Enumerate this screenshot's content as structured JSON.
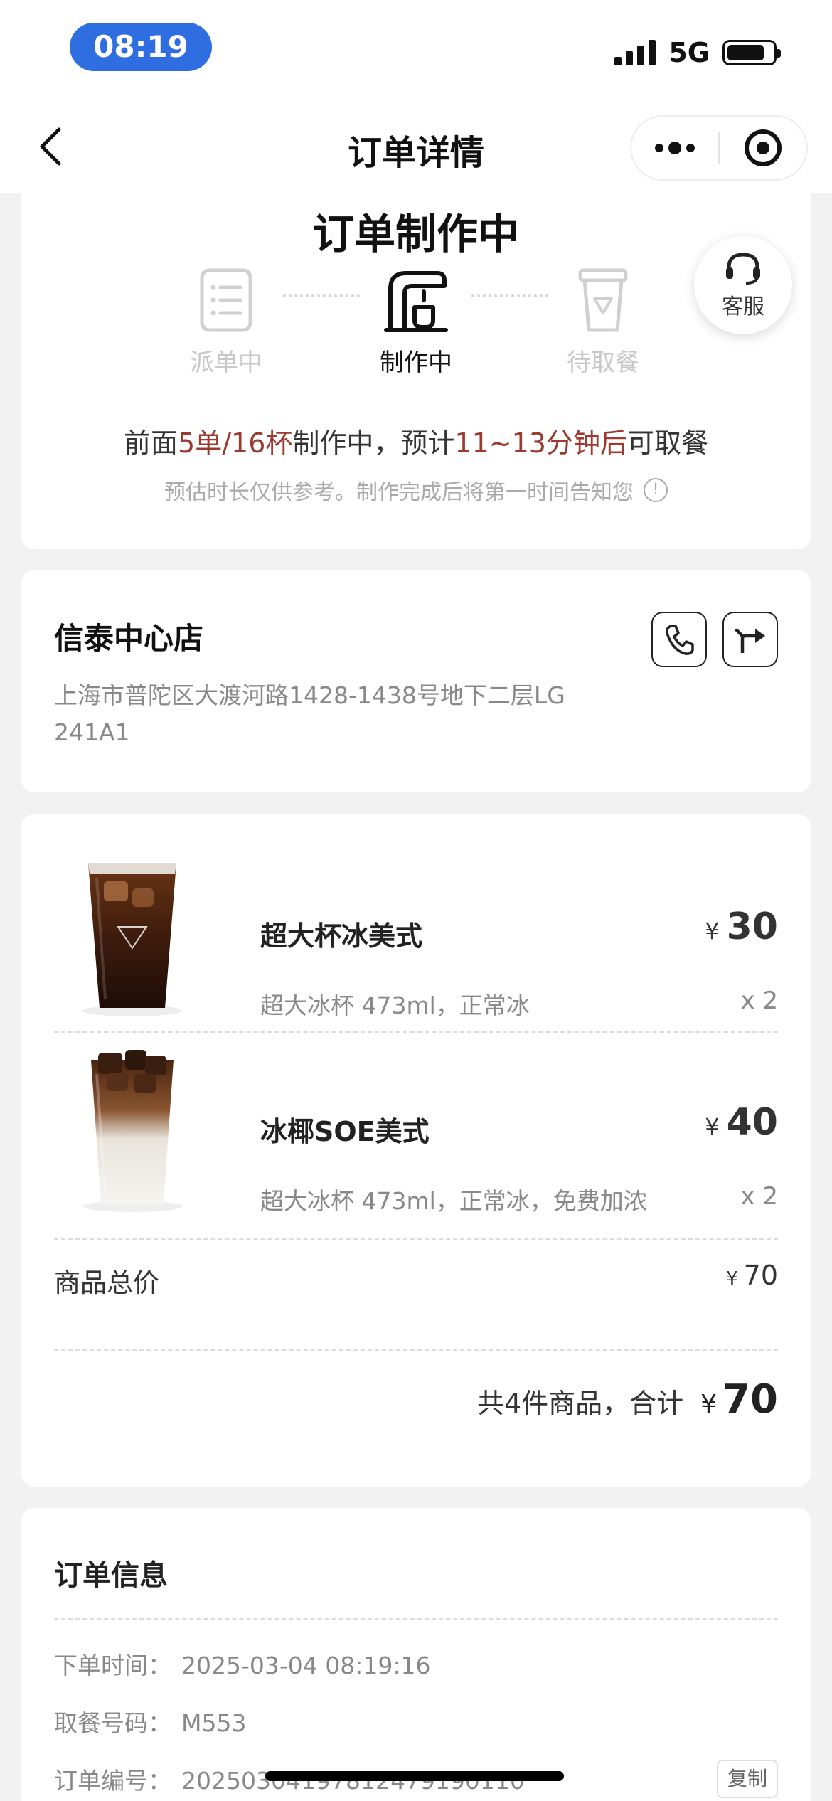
{
  "status_bar": {
    "time": "08:19",
    "network": "5G"
  },
  "nav": {
    "title": "订单详情"
  },
  "progress": {
    "title": "订单制作中",
    "steps": [
      {
        "label": "派单中",
        "icon": "document-list-icon",
        "state": "done"
      },
      {
        "label": "制作中",
        "icon": "coffee-machine-icon",
        "state": "active"
      },
      {
        "label": "待取餐",
        "icon": "cup-icon",
        "state": "pending"
      }
    ],
    "service_label": "客服",
    "eta": {
      "prefix": "前面",
      "orders_cups": "5单/16杯",
      "middle": "制作中，预计",
      "minutes": "11~13分钟后",
      "suffix": "可取餐"
    },
    "note": "预估时长仅供参考。制作完成后将第一时间告知您"
  },
  "store": {
    "name": "信泰中心店",
    "address": "上海市普陀区大渡河路1428-1438号地下二层LG 241A1"
  },
  "items": [
    {
      "name": "超大杯冰美式",
      "spec": "超大冰杯 473ml，正常冰",
      "currency": "¥",
      "price": "30",
      "qty": "x 2"
    },
    {
      "name": "冰椰SOE美式",
      "spec": "超大冰杯 473ml，正常冰，免费加浓",
      "currency": "¥",
      "price": "40",
      "qty": "x 2"
    }
  ],
  "summary": {
    "subtotal_label": "商品总价",
    "subtotal_currency": "¥",
    "subtotal_value": "70",
    "total_text": "共4件商品，合计",
    "total_currency": "¥",
    "total_value": "70"
  },
  "order_info": {
    "title": "订单信息",
    "rows": [
      {
        "label": "下单时间：",
        "value": "2025-03-04 08:19:16"
      },
      {
        "label": "取餐号码：",
        "value": "M553"
      },
      {
        "label": "订单编号：",
        "value": "20250304197812479190110"
      }
    ],
    "copy_label": "复制"
  },
  "colors": {
    "accent": "#2f6ee0",
    "highlight": "#9b3b30"
  }
}
